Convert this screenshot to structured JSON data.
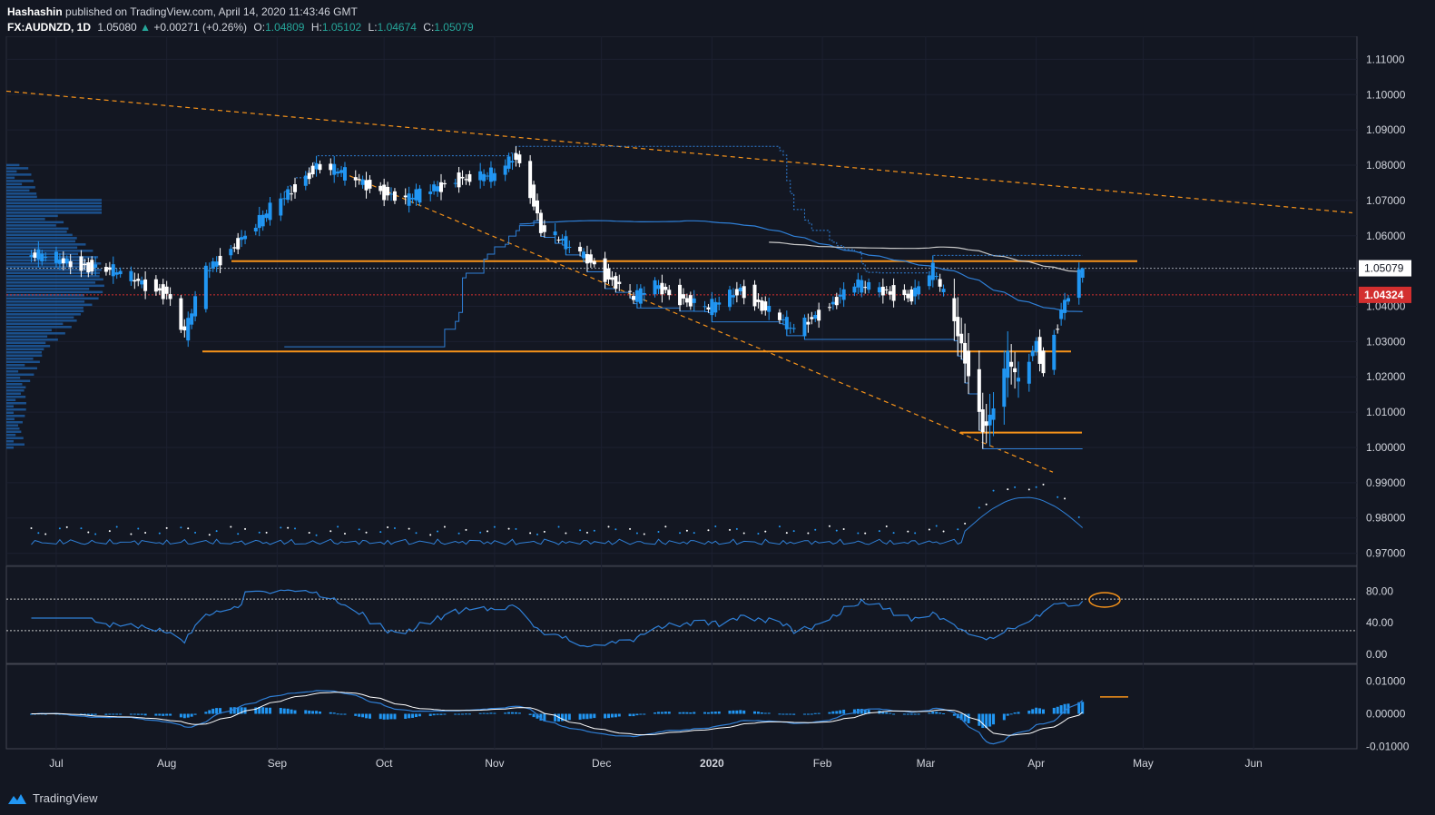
{
  "header": {
    "publisher": "Hashashin",
    "published_text": "published on TradingView.com, April 14, 2020 11:43:46 GMT",
    "symbol": "FX:AUDNZD, 1D",
    "last": "1.05080",
    "change_arrow": "▲",
    "change": "+0.00271 (+0.26%)",
    "o_label": "O:",
    "o": "1.04809",
    "h_label": "H:",
    "h": "1.05102",
    "l_label": "L:",
    "l": "1.04674",
    "c_label": "C:",
    "c": "1.05079"
  },
  "footer": {
    "brand": "TradingView",
    "icon": "tradingview-logo-icon"
  },
  "colors": {
    "background": "#131722",
    "up": "#2196f3",
    "down": "#ffffff",
    "orange": "#f7931a",
    "ma_blue": "#2f7fd6",
    "ma_white": "#c8c8c8",
    "grid": "#2a2e39",
    "price_red": "#d32f2f"
  },
  "chart_data": {
    "type": "candlestick",
    "symbol": "AUDNZD",
    "timeframe": "1D",
    "x_labels": [
      "Jul",
      "Aug",
      "Sep",
      "Oct",
      "Nov",
      "Dec",
      "2020",
      "Feb",
      "Mar",
      "Apr",
      "May",
      "Jun"
    ],
    "price_axis": {
      "ticks": [
        "1.11000",
        "1.10000",
        "1.09000",
        "1.08000",
        "1.07000",
        "1.06000",
        "1.05000",
        "1.04000",
        "1.03000",
        "1.02000",
        "1.01000",
        "1.00000",
        "0.99000",
        "0.98000",
        "0.97000"
      ],
      "current_price": "1.05079",
      "marked_price": "1.04324"
    },
    "rsi_axis": {
      "ticks": [
        "80.00",
        "40.00",
        "0.00"
      ],
      "levels": [
        70,
        30
      ]
    },
    "macd_axis": {
      "ticks": [
        "0.01000",
        "0.00000",
        "-0.01000"
      ]
    },
    "key_levels": [
      1.0528,
      1.0272,
      1.0042
    ],
    "anchors": [
      {
        "date": "2019-06-24",
        "price": 1.0545
      },
      {
        "date": "2019-07-15",
        "price": 1.0505
      },
      {
        "date": "2019-08-01",
        "price": 1.044
      },
      {
        "date": "2019-08-06",
        "price": 1.032
      },
      {
        "date": "2019-08-12",
        "price": 1.05
      },
      {
        "date": "2019-08-27",
        "price": 1.064
      },
      {
        "date": "2019-09-12",
        "price": 1.08
      },
      {
        "date": "2019-09-18",
        "price": 1.078
      },
      {
        "date": "2019-10-07",
        "price": 1.07
      },
      {
        "date": "2019-10-21",
        "price": 1.076
      },
      {
        "date": "2019-11-01",
        "price": 1.077
      },
      {
        "date": "2019-11-07",
        "price": 1.083
      },
      {
        "date": "2019-11-12",
        "price": 1.07
      },
      {
        "date": "2019-11-14",
        "price": 1.062
      },
      {
        "date": "2019-11-28",
        "price": 1.053
      },
      {
        "date": "2019-12-10",
        "price": 1.042
      },
      {
        "date": "2019-12-16",
        "price": 1.046
      },
      {
        "date": "2019-12-31",
        "price": 1.039
      },
      {
        "date": "2020-01-09",
        "price": 1.045
      },
      {
        "date": "2020-01-24",
        "price": 1.033
      },
      {
        "date": "2020-02-10",
        "price": 1.046
      },
      {
        "date": "2020-02-26",
        "price": 1.043
      },
      {
        "date": "2020-03-03",
        "price": 1.05
      },
      {
        "date": "2020-03-09",
        "price": 1.036
      },
      {
        "date": "2020-03-13",
        "price": 1.022
      },
      {
        "date": "2020-03-17",
        "price": 1.006
      },
      {
        "date": "2020-03-19",
        "price": 1.008
      },
      {
        "date": "2020-03-24",
        "price": 1.025
      },
      {
        "date": "2020-03-27",
        "price": 1.018
      },
      {
        "date": "2020-04-01",
        "price": 1.03
      },
      {
        "date": "2020-04-03",
        "price": 1.022
      },
      {
        "date": "2020-04-08",
        "price": 1.039
      },
      {
        "date": "2020-04-14",
        "price": 1.0508
      }
    ]
  }
}
